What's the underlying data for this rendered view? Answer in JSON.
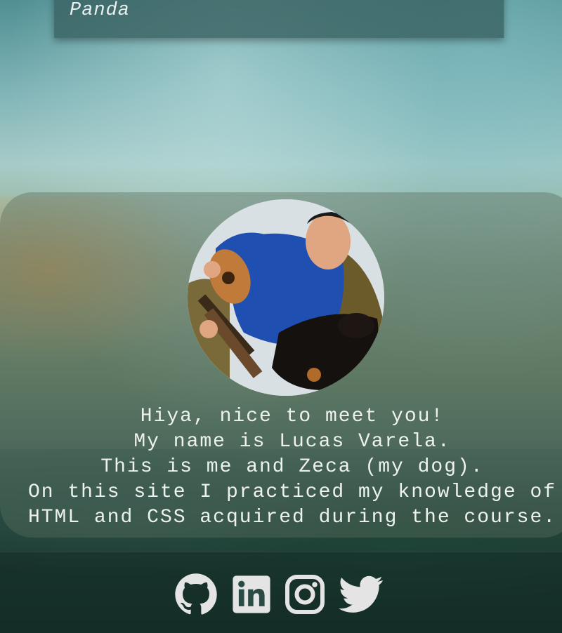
{
  "header": {
    "card_text": "Panda"
  },
  "about": {
    "lines": [
      "Hiya, nice to meet you!",
      "My name is Lucas Varela.",
      "This is me and Zeca (my dog).",
      "On this site I practiced my knowledge of",
      "HTML and CSS acquired during the course."
    ]
  },
  "footer": {
    "icons": [
      "github-icon",
      "linkedin-icon",
      "instagram-icon",
      "twitter-icon"
    ],
    "icon_color": "#e4e4e4"
  }
}
